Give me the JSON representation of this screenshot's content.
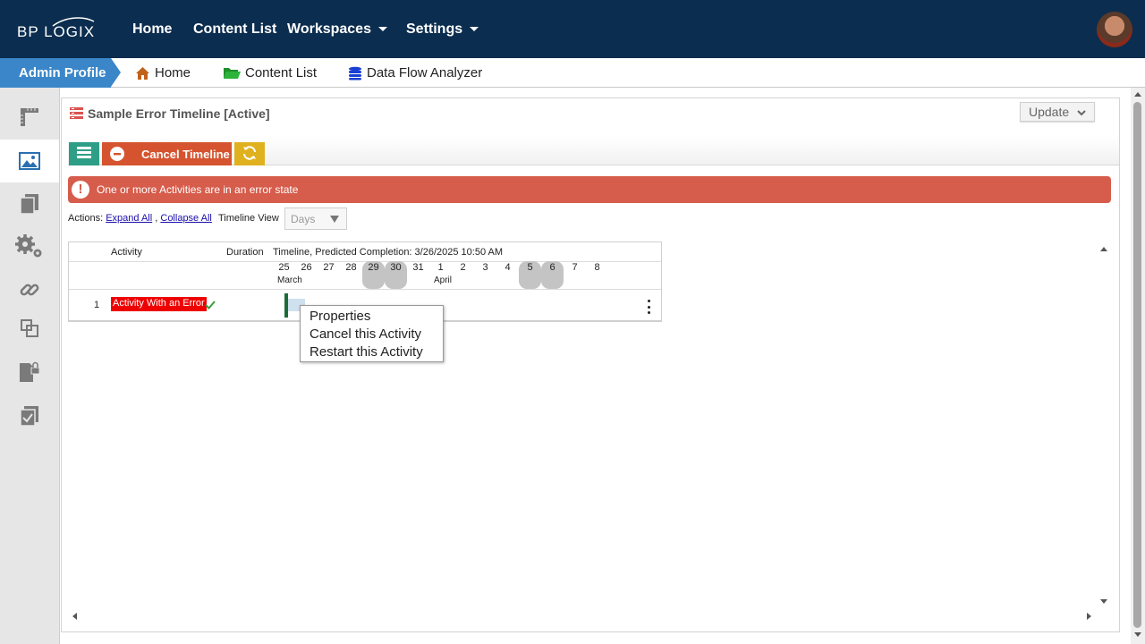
{
  "header": {
    "logo_text": "BP LOGIX",
    "nav": [
      {
        "label": "Home",
        "dropdown": false
      },
      {
        "label": "Content List",
        "dropdown": false
      },
      {
        "label": "Workspaces",
        "dropdown": true
      },
      {
        "label": "Settings",
        "dropdown": true
      }
    ],
    "bg_color": "#0b2d4f"
  },
  "breadcrumb": {
    "profile": "Admin Profile",
    "items": [
      {
        "label": "Home",
        "icon": "home-icon"
      },
      {
        "label": "Content List",
        "icon": "folder-open-icon"
      },
      {
        "label": "Data Flow Analyzer",
        "icon": "database-icon"
      }
    ]
  },
  "sidebar": {
    "items": [
      "ruler-icon",
      "image-icon",
      "copy-icon",
      "gears-icon",
      "link-icon",
      "resize-icon",
      "locked-document-icon",
      "checked-document-icon"
    ],
    "active_index": 1
  },
  "panel": {
    "title": "Sample Error Timeline [Active]",
    "update_label": "Update",
    "toolbar": {
      "cancel_label": "Cancel Timeline"
    },
    "error_message": "One or more Activities are in an error state",
    "actions": {
      "prefix": "Actions:",
      "expand_all": "Expand All",
      "separator": ",",
      "collapse_all": "Collapse All",
      "timeline_view_label": "Timeline View",
      "timeline_view_value": "Days"
    },
    "grid": {
      "col_activity": "Activity",
      "col_duration": "Duration",
      "col_timeline": "Timeline, Predicted Completion: 3/26/2025 10:50 AM",
      "days": [
        {
          "d": "25",
          "weekend": false
        },
        {
          "d": "26",
          "weekend": false
        },
        {
          "d": "27",
          "weekend": false
        },
        {
          "d": "28",
          "weekend": false
        },
        {
          "d": "29",
          "weekend": true
        },
        {
          "d": "30",
          "weekend": true
        },
        {
          "d": "31",
          "weekend": false
        },
        {
          "d": "1",
          "weekend": false
        },
        {
          "d": "2",
          "weekend": false
        },
        {
          "d": "3",
          "weekend": false
        },
        {
          "d": "4",
          "weekend": false
        },
        {
          "d": "5",
          "weekend": true
        },
        {
          "d": "6",
          "weekend": true
        },
        {
          "d": "7",
          "weekend": false
        },
        {
          "d": "8",
          "weekend": false
        }
      ],
      "month_march": "March",
      "month_april": "April",
      "rows": [
        {
          "num": "1",
          "activity": "Activity With an Error"
        }
      ]
    },
    "context_menu": [
      "Properties",
      "Cancel this Activity",
      "Restart this Activity"
    ]
  },
  "colors": {
    "error": "#d65c4b",
    "cancel_button": "#d5542f",
    "list_button": "#2f9e86",
    "refresh_button": "#e0b11f",
    "profile_tab": "#3a86c8"
  }
}
